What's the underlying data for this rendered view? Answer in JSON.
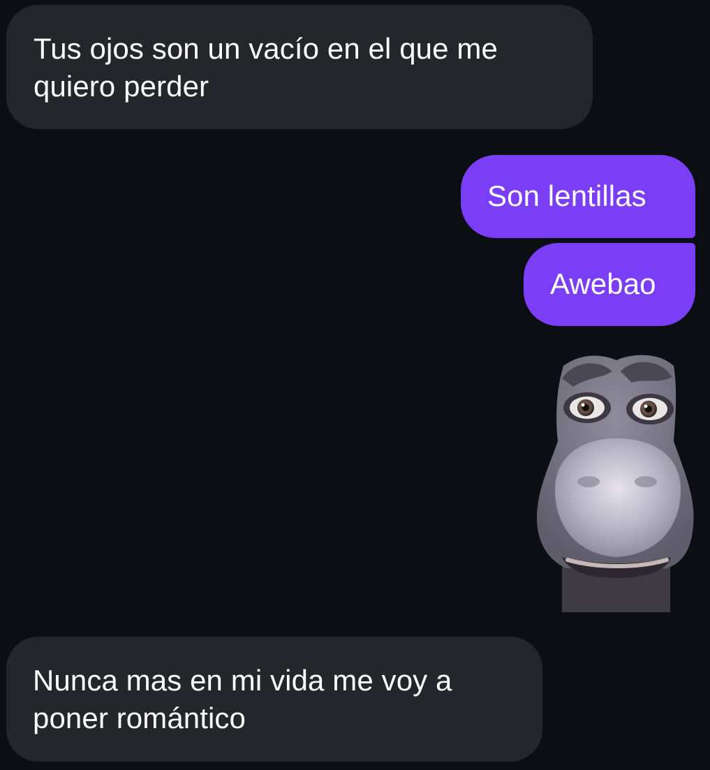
{
  "conversation": {
    "messages": [
      {
        "direction": "incoming",
        "type": "text",
        "text": "Tus ojos son un vacío en el que me quiero perder"
      },
      {
        "direction": "outgoing",
        "type": "text",
        "text": "Son lentillas"
      },
      {
        "direction": "outgoing",
        "type": "text",
        "text": "Awebao"
      },
      {
        "direction": "outgoing",
        "type": "sticker",
        "sticker": "donkey-face-sticker"
      },
      {
        "direction": "incoming",
        "type": "text",
        "text": "Nunca mas en mi vida me voy a poner romántico"
      }
    ]
  },
  "colors": {
    "background": "#0b0f13",
    "incoming_bubble": "#23272b",
    "outgoing_bubble": "#7a3ef7",
    "text": "#ffffff"
  }
}
